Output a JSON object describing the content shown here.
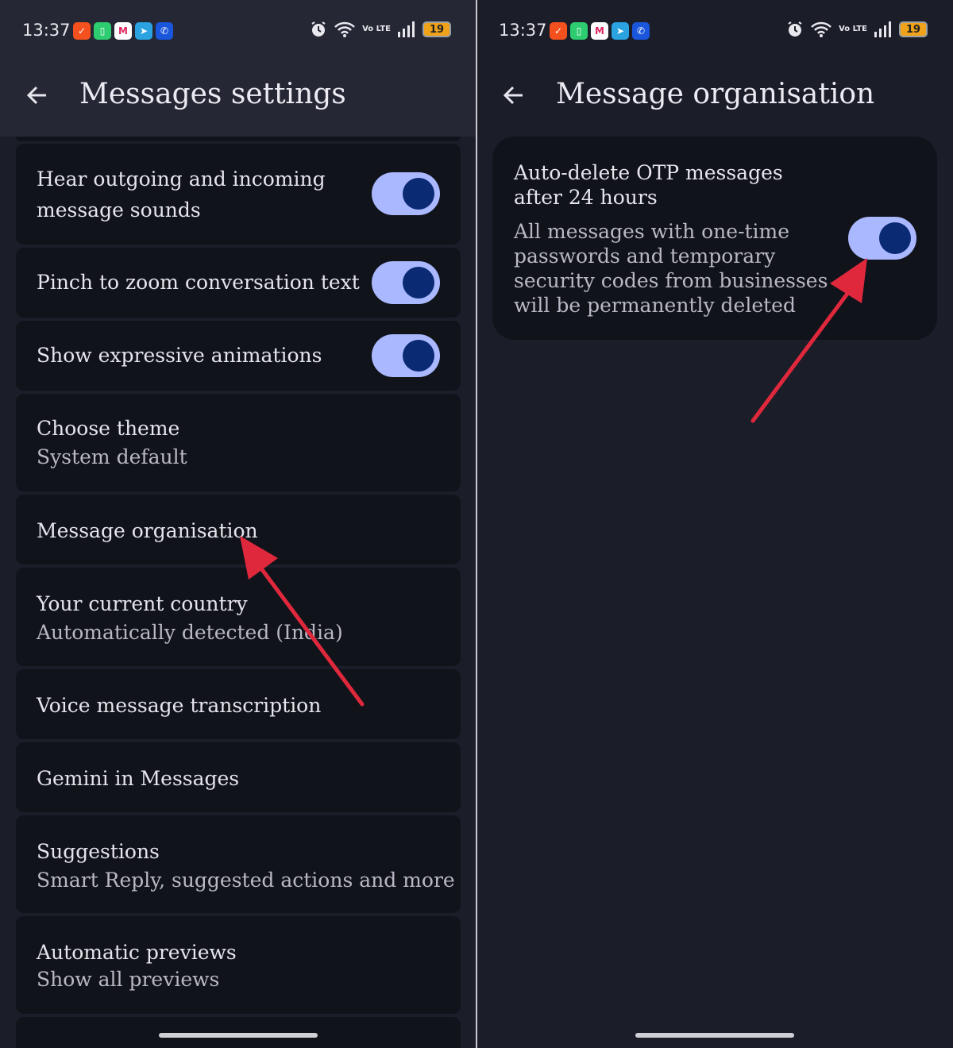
{
  "status_bar": {
    "time": "13:37",
    "battery": "19",
    "volte": "Vo LTE",
    "notification_icons": [
      "check-app-icon",
      "battery-app-icon",
      "m-app-icon",
      "telegram-icon",
      "phone-app-icon"
    ],
    "system_icons": [
      "alarm-icon",
      "wifi-icon",
      "volte-icon",
      "signal-icon",
      "battery-icon"
    ]
  },
  "left_screen": {
    "title": "Messages settings",
    "settings": [
      {
        "title": "Hear outgoing and incoming message sounds",
        "toggle": true
      },
      {
        "title": "Pinch to zoom conversation text",
        "toggle": true
      },
      {
        "title": "Show expressive animations",
        "toggle": true
      },
      {
        "title": "Choose theme",
        "subtitle": "System default"
      },
      {
        "title": "Message organisation"
      },
      {
        "title": "Your current country",
        "subtitle": "Automatically detected (India)"
      },
      {
        "title": "Voice message transcription"
      },
      {
        "title": "Gemini in Messages"
      },
      {
        "title": "Suggestions",
        "subtitle": "Smart Reply, suggested actions and more"
      },
      {
        "title": "Automatic previews",
        "subtitle": "Show all previews"
      }
    ]
  },
  "right_screen": {
    "title": "Message organisation",
    "setting": {
      "title": "Auto-delete OTP messages after 24 hours",
      "description": "All messages with one-time passwords and temporary security codes from businesses will be permanently deleted",
      "toggle": true
    }
  },
  "colors": {
    "background": "#1b1d28",
    "header": "#252834",
    "row": "#11131b",
    "toggle_track": "#aab8ff",
    "toggle_knob": "#0a2a73",
    "annotation_arrow": "#e0283c"
  }
}
